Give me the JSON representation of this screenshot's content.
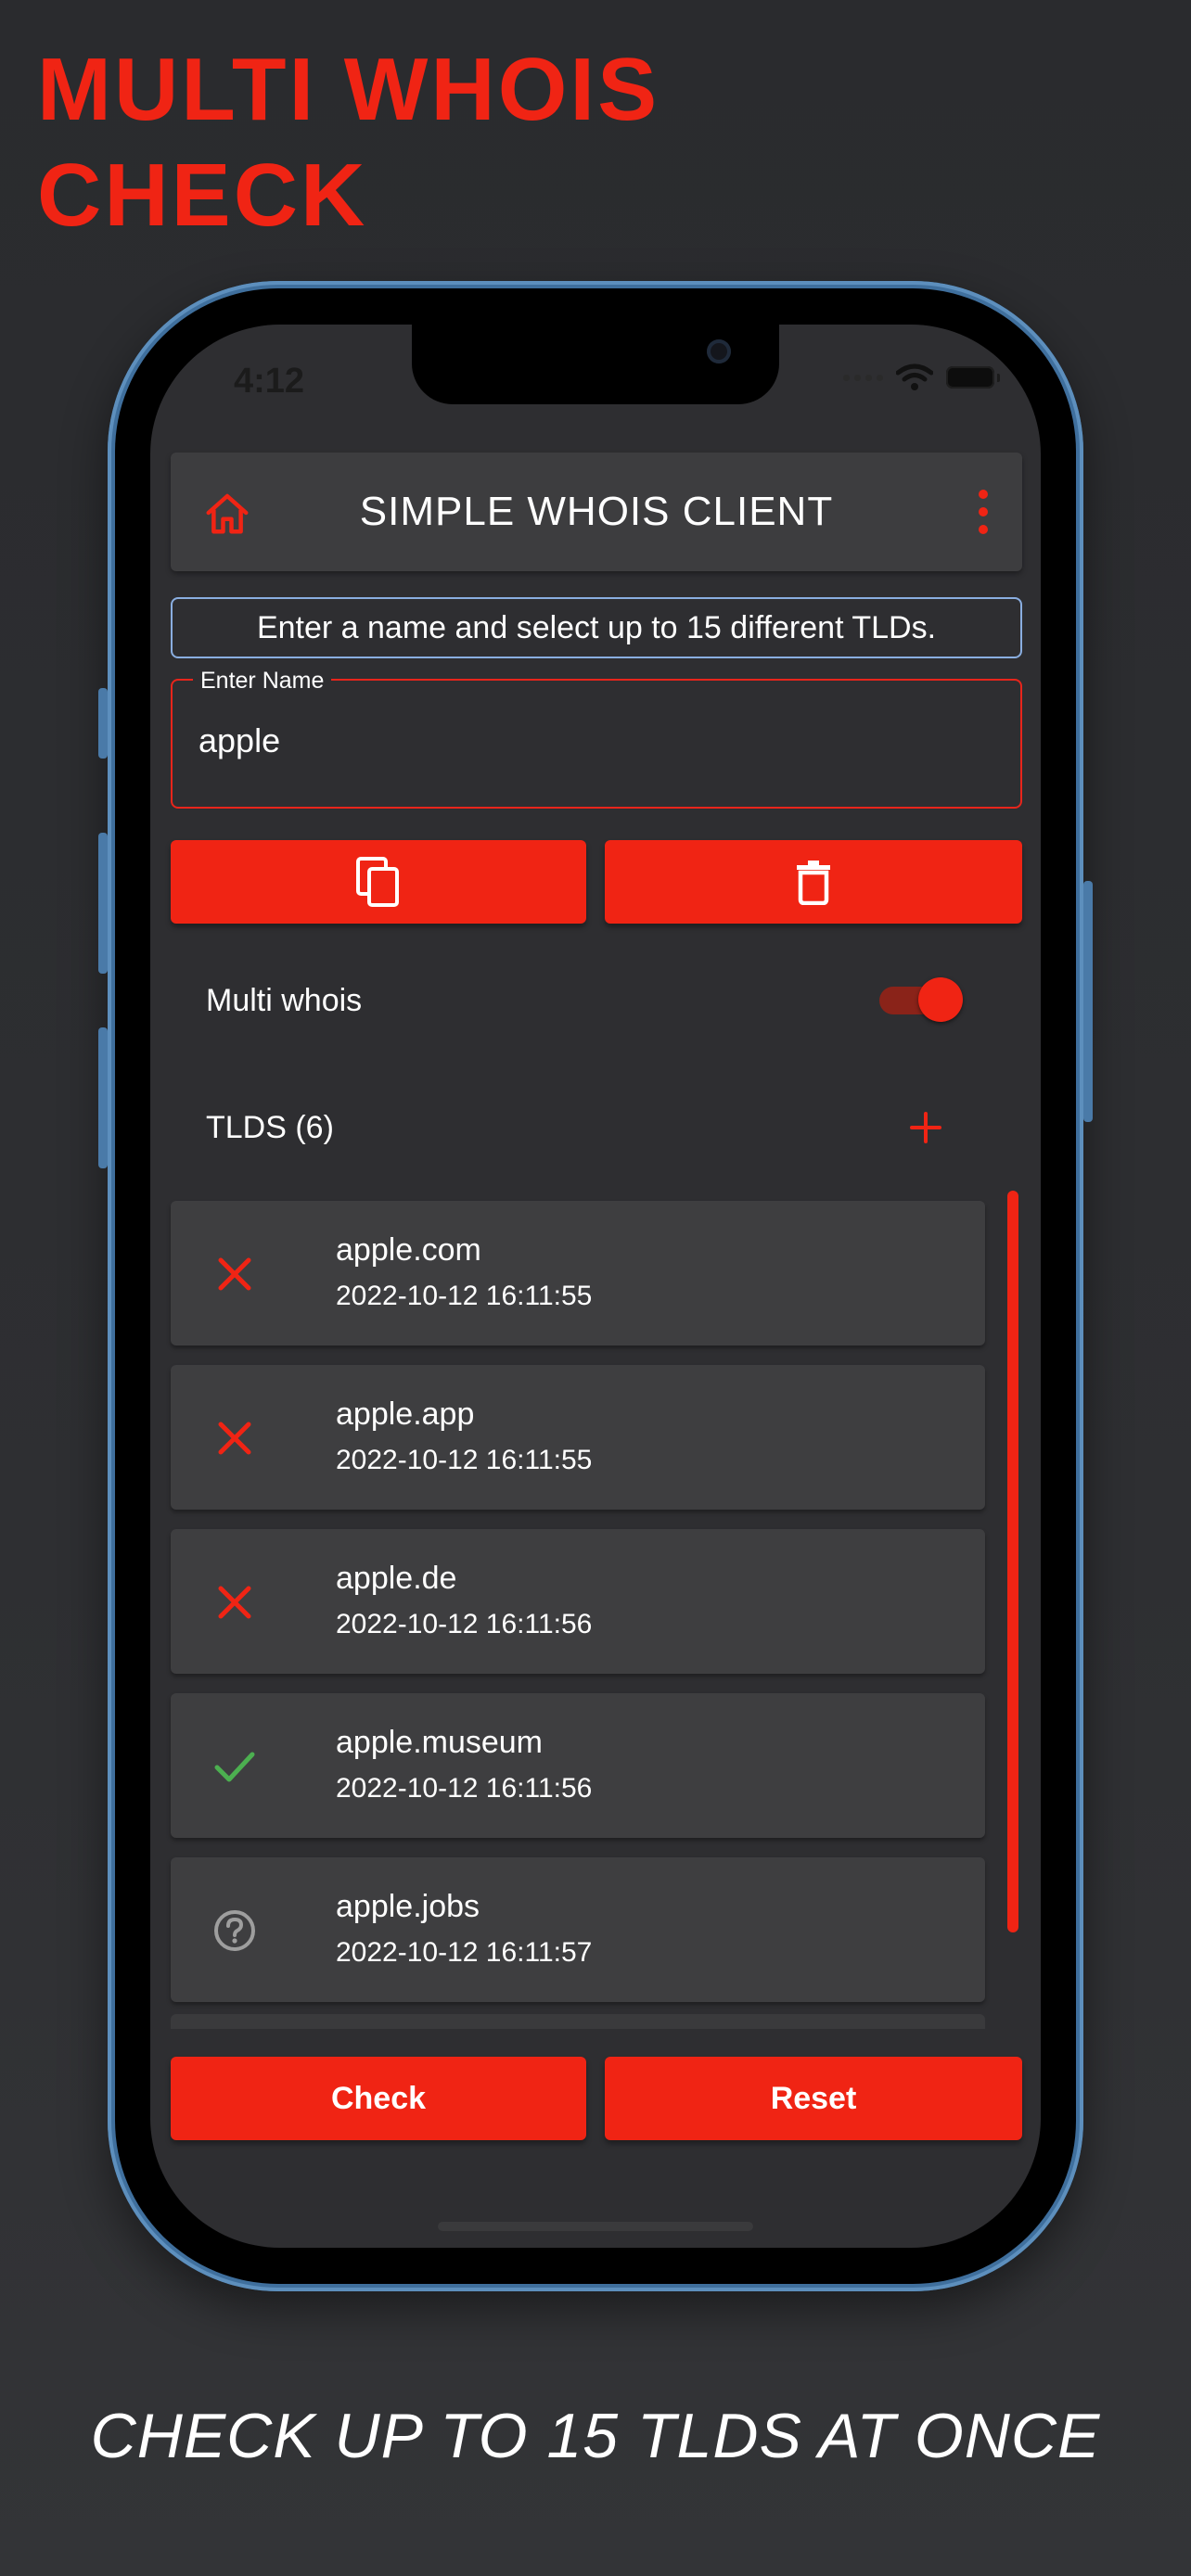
{
  "promo": {
    "headline_line1": "MULTI WHOIS",
    "headline_line2": "CHECK",
    "tagline": "CHECK UP TO 15 TLDS AT ONCE"
  },
  "status_bar": {
    "time": "4:12"
  },
  "app_bar": {
    "title": "SIMPLE WHOIS CLIENT",
    "home_icon": "home-icon",
    "menu_icon": "more-vert-icon"
  },
  "hint": "Enter a name and select up to 15 different TLDs.",
  "name_field": {
    "label": "Enter Name",
    "value": "apple"
  },
  "action_buttons": {
    "copy_icon": "copy-icon",
    "delete_icon": "trash-icon"
  },
  "multi_whois": {
    "label": "Multi whois",
    "enabled": true
  },
  "tlds": {
    "label": "TLDS (6)",
    "add_icon": "plus-icon"
  },
  "results": [
    {
      "domain": "apple.com",
      "timestamp": "2022-10-12 16:11:55",
      "status": "taken"
    },
    {
      "domain": "apple.app",
      "timestamp": "2022-10-12 16:11:55",
      "status": "taken"
    },
    {
      "domain": "apple.de",
      "timestamp": "2022-10-12 16:11:56",
      "status": "taken"
    },
    {
      "domain": "apple.museum",
      "timestamp": "2022-10-12 16:11:56",
      "status": "available"
    },
    {
      "domain": "apple.jobs",
      "timestamp": "2022-10-12 16:11:57",
      "status": "unknown"
    }
  ],
  "footer_buttons": {
    "check": "Check",
    "reset": "Reset"
  },
  "colors": {
    "accent": "#f02414",
    "available": "#4caf50",
    "unknown": "#9e9e9e",
    "card": "#3e3e40",
    "background": "#2e2e31"
  }
}
